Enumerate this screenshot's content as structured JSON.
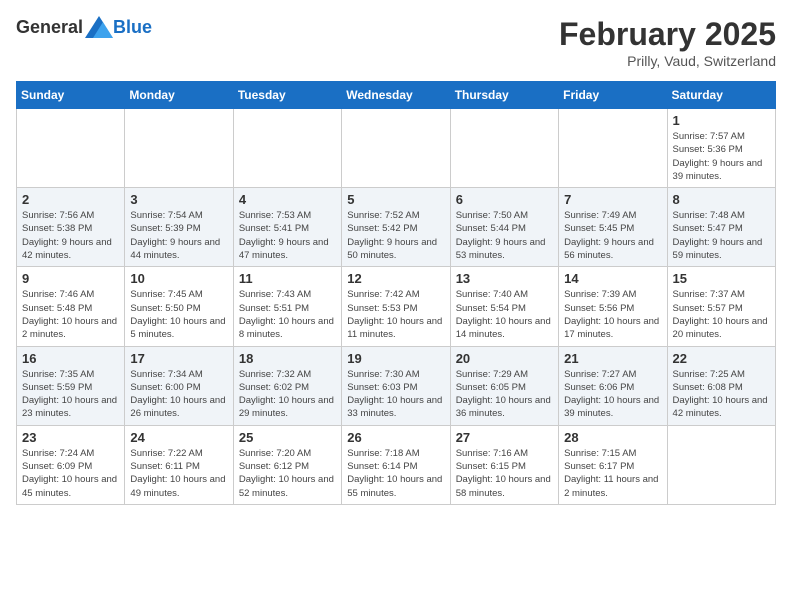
{
  "header": {
    "logo_general": "General",
    "logo_blue": "Blue",
    "month": "February 2025",
    "location": "Prilly, Vaud, Switzerland"
  },
  "weekdays": [
    "Sunday",
    "Monday",
    "Tuesday",
    "Wednesday",
    "Thursday",
    "Friday",
    "Saturday"
  ],
  "weeks": [
    [
      {
        "day": "",
        "info": ""
      },
      {
        "day": "",
        "info": ""
      },
      {
        "day": "",
        "info": ""
      },
      {
        "day": "",
        "info": ""
      },
      {
        "day": "",
        "info": ""
      },
      {
        "day": "",
        "info": ""
      },
      {
        "day": "1",
        "info": "Sunrise: 7:57 AM\nSunset: 5:36 PM\nDaylight: 9 hours and 39 minutes."
      }
    ],
    [
      {
        "day": "2",
        "info": "Sunrise: 7:56 AM\nSunset: 5:38 PM\nDaylight: 9 hours and 42 minutes."
      },
      {
        "day": "3",
        "info": "Sunrise: 7:54 AM\nSunset: 5:39 PM\nDaylight: 9 hours and 44 minutes."
      },
      {
        "day": "4",
        "info": "Sunrise: 7:53 AM\nSunset: 5:41 PM\nDaylight: 9 hours and 47 minutes."
      },
      {
        "day": "5",
        "info": "Sunrise: 7:52 AM\nSunset: 5:42 PM\nDaylight: 9 hours and 50 minutes."
      },
      {
        "day": "6",
        "info": "Sunrise: 7:50 AM\nSunset: 5:44 PM\nDaylight: 9 hours and 53 minutes."
      },
      {
        "day": "7",
        "info": "Sunrise: 7:49 AM\nSunset: 5:45 PM\nDaylight: 9 hours and 56 minutes."
      },
      {
        "day": "8",
        "info": "Sunrise: 7:48 AM\nSunset: 5:47 PM\nDaylight: 9 hours and 59 minutes."
      }
    ],
    [
      {
        "day": "9",
        "info": "Sunrise: 7:46 AM\nSunset: 5:48 PM\nDaylight: 10 hours and 2 minutes."
      },
      {
        "day": "10",
        "info": "Sunrise: 7:45 AM\nSunset: 5:50 PM\nDaylight: 10 hours and 5 minutes."
      },
      {
        "day": "11",
        "info": "Sunrise: 7:43 AM\nSunset: 5:51 PM\nDaylight: 10 hours and 8 minutes."
      },
      {
        "day": "12",
        "info": "Sunrise: 7:42 AM\nSunset: 5:53 PM\nDaylight: 10 hours and 11 minutes."
      },
      {
        "day": "13",
        "info": "Sunrise: 7:40 AM\nSunset: 5:54 PM\nDaylight: 10 hours and 14 minutes."
      },
      {
        "day": "14",
        "info": "Sunrise: 7:39 AM\nSunset: 5:56 PM\nDaylight: 10 hours and 17 minutes."
      },
      {
        "day": "15",
        "info": "Sunrise: 7:37 AM\nSunset: 5:57 PM\nDaylight: 10 hours and 20 minutes."
      }
    ],
    [
      {
        "day": "16",
        "info": "Sunrise: 7:35 AM\nSunset: 5:59 PM\nDaylight: 10 hours and 23 minutes."
      },
      {
        "day": "17",
        "info": "Sunrise: 7:34 AM\nSunset: 6:00 PM\nDaylight: 10 hours and 26 minutes."
      },
      {
        "day": "18",
        "info": "Sunrise: 7:32 AM\nSunset: 6:02 PM\nDaylight: 10 hours and 29 minutes."
      },
      {
        "day": "19",
        "info": "Sunrise: 7:30 AM\nSunset: 6:03 PM\nDaylight: 10 hours and 33 minutes."
      },
      {
        "day": "20",
        "info": "Sunrise: 7:29 AM\nSunset: 6:05 PM\nDaylight: 10 hours and 36 minutes."
      },
      {
        "day": "21",
        "info": "Sunrise: 7:27 AM\nSunset: 6:06 PM\nDaylight: 10 hours and 39 minutes."
      },
      {
        "day": "22",
        "info": "Sunrise: 7:25 AM\nSunset: 6:08 PM\nDaylight: 10 hours and 42 minutes."
      }
    ],
    [
      {
        "day": "23",
        "info": "Sunrise: 7:24 AM\nSunset: 6:09 PM\nDaylight: 10 hours and 45 minutes."
      },
      {
        "day": "24",
        "info": "Sunrise: 7:22 AM\nSunset: 6:11 PM\nDaylight: 10 hours and 49 minutes."
      },
      {
        "day": "25",
        "info": "Sunrise: 7:20 AM\nSunset: 6:12 PM\nDaylight: 10 hours and 52 minutes."
      },
      {
        "day": "26",
        "info": "Sunrise: 7:18 AM\nSunset: 6:14 PM\nDaylight: 10 hours and 55 minutes."
      },
      {
        "day": "27",
        "info": "Sunrise: 7:16 AM\nSunset: 6:15 PM\nDaylight: 10 hours and 58 minutes."
      },
      {
        "day": "28",
        "info": "Sunrise: 7:15 AM\nSunset: 6:17 PM\nDaylight: 11 hours and 2 minutes."
      },
      {
        "day": "",
        "info": ""
      }
    ]
  ]
}
